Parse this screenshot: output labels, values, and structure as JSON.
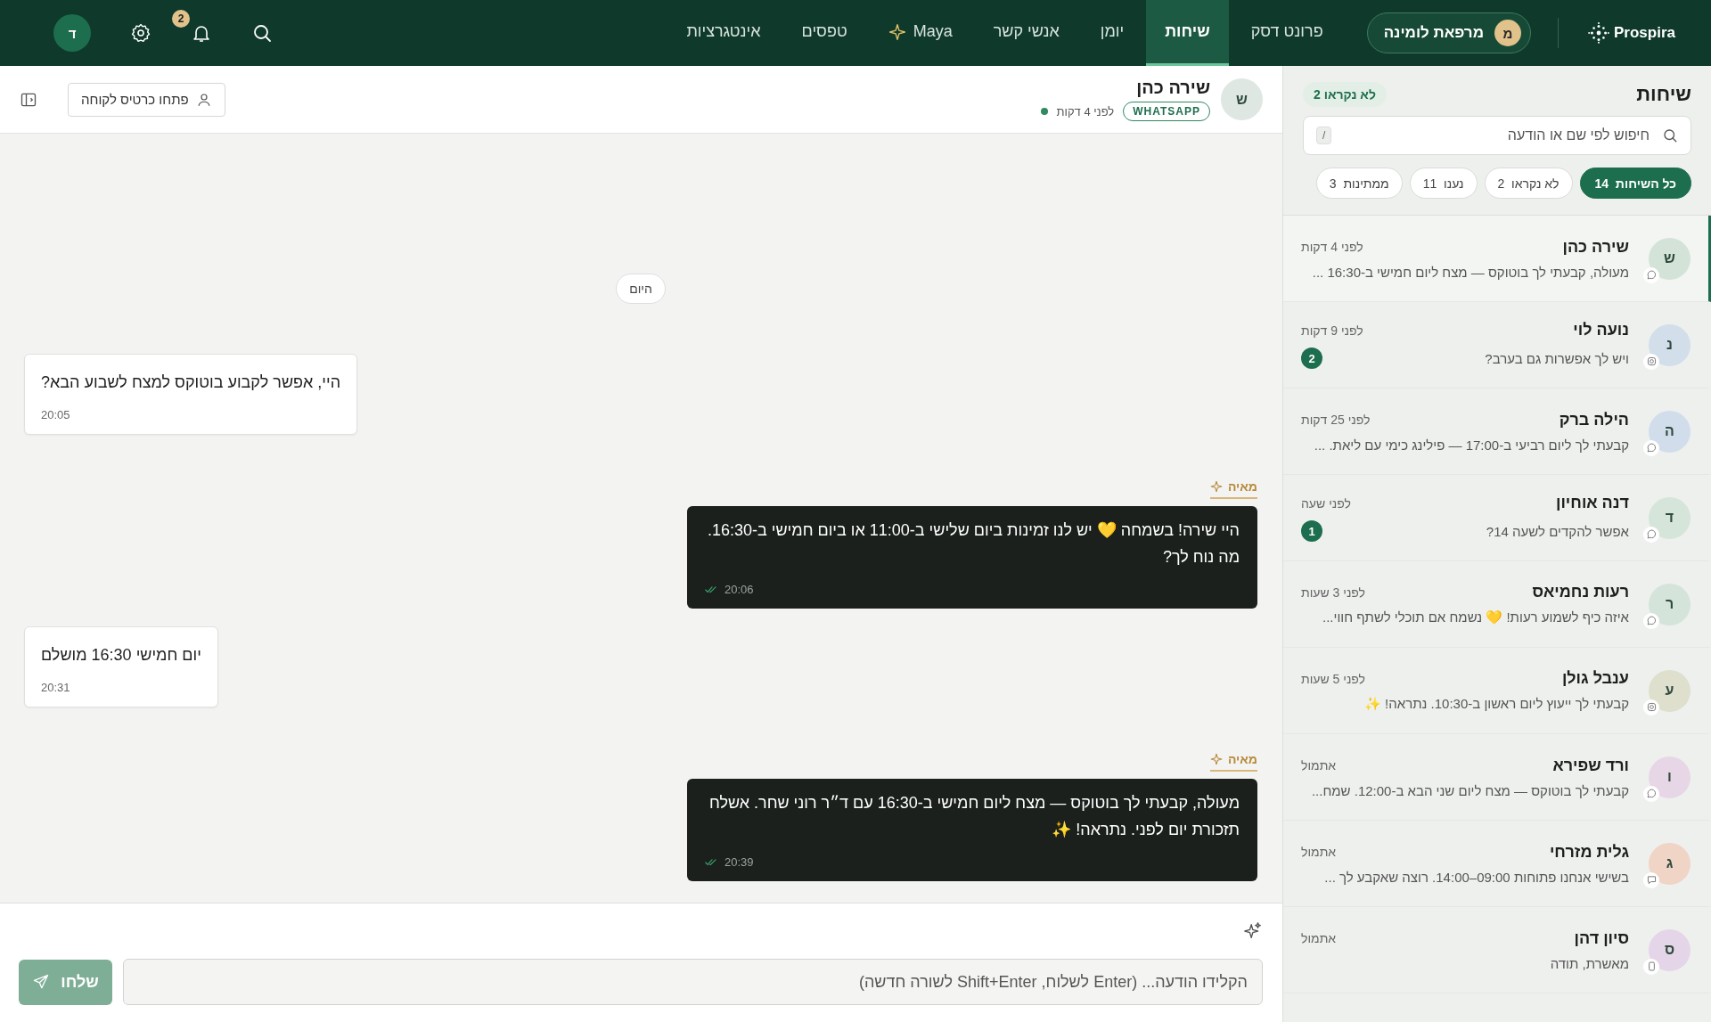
{
  "nav": {
    "brand": "Prospira",
    "clinic": {
      "initial": "מ",
      "name": "מרפאת לומינה"
    },
    "tabs": [
      {
        "label": "פרונט דסק",
        "kind": "plain",
        "selected": false
      },
      {
        "label": "שיחות",
        "kind": "plain",
        "selected": true
      },
      {
        "label": "יומן",
        "kind": "plain",
        "selected": false
      },
      {
        "label": "אנשי קשר",
        "kind": "plain",
        "selected": false
      },
      {
        "label": "Maya",
        "kind": "ai",
        "selected": false
      },
      {
        "label": "טפסים",
        "kind": "plain",
        "selected": false
      },
      {
        "label": "אינטגרציות",
        "kind": "plain",
        "selected": false
      }
    ],
    "notifications": "2",
    "user_initial": "ד"
  },
  "sidebar": {
    "title": "שיחות",
    "unread_badge": "לא נקראו 2",
    "search": {
      "placeholder": "חיפוש לפי שם או הודעה",
      "shortcut": "/"
    },
    "filters": [
      {
        "label": "כל השיחות",
        "count": "14",
        "selected": true
      },
      {
        "label": "לא נקראו",
        "count": "2",
        "selected": false
      },
      {
        "label": "נענו",
        "count": "11",
        "selected": false
      },
      {
        "label": "ממתינות",
        "count": "3",
        "selected": false
      }
    ],
    "conversations": [
      {
        "initial": "ש",
        "color": "#d3e3d7",
        "name": "שירה כהן",
        "time": "לפני 4 דקות",
        "preview": "מעולה, קבעתי לך בוטוקס — מצח ליום חמישי ב-16:30 ...",
        "kind": "whatsapp",
        "selected": true
      },
      {
        "initial": "נ",
        "color": "#d2deea",
        "name": "נועה לוי",
        "time": "לפני 9 דקות",
        "preview": "ויש לך אפשרות גם בערב?",
        "kind": "instagram",
        "unread": "2",
        "selected": false
      },
      {
        "initial": "ה",
        "color": "#d2ddec",
        "name": "הילה ברק",
        "time": "לפני 25 דקות",
        "preview": "קבעתי לך ליום רביעי ב-17:00 — פילינג כימי עם ליאת. ...",
        "kind": "whatsapp",
        "selected": false
      },
      {
        "initial": "ד",
        "color": "#d5e5d9",
        "name": "דנה אוחיון",
        "time": "לפני שעה",
        "preview": "אפשר להקדים לשעה 14?",
        "kind": "whatsapp",
        "unread": "1",
        "selected": false
      },
      {
        "initial": "ר",
        "color": "#d4e4da",
        "name": "רעות נחמיאס",
        "time": "לפני 3 שעות",
        "preview": "איזה כיף לשמוע רעות! 💛 נשמח אם תוכלי לשתף חווי...",
        "kind": "whatsapp",
        "selected": false
      },
      {
        "initial": "ע",
        "color": "#dfdfcd",
        "name": "ענבל גולן",
        "time": "לפני 5 שעות",
        "preview": "קבעתי לך ייעוץ ליום ראשון ב-10:30. נתראה! ✨",
        "kind": "instagram",
        "selected": false
      },
      {
        "initial": "ו",
        "color": "#e7d7e6",
        "name": "ורד שפירא",
        "time": "אתמול",
        "preview": "קבעתי לך בוטוקס — מצח ליום שני הבא ב-12:00. שמח...",
        "kind": "whatsapp",
        "selected": false
      },
      {
        "initial": "ג",
        "color": "#f0d4c6",
        "name": "גלית מזרחי",
        "time": "אתמול",
        "preview": "בשישי אנחנו פתוחות 09:00–14:00. רוצה שאקבע לך ...",
        "kind": "sms",
        "selected": false
      },
      {
        "initial": "ס",
        "color": "#e5d5e8",
        "name": "סיון דהן",
        "time": "אתמול",
        "preview": "מאשרת, תודה",
        "kind": "app",
        "selected": false
      }
    ]
  },
  "chat": {
    "contact": {
      "initial": "ש",
      "name": "שירה כהן",
      "channel": "WHATSAPP",
      "last_seen": "לפני 4 דקות",
      "online": true
    },
    "open_card_button": "פתחו כרטיס לקוחה",
    "messages": [
      {
        "kind": "date",
        "text": "היום"
      },
      {
        "kind": "incoming",
        "text": "היי, אפשר לקבוע בוטוקס למצח לשבוע הבא?",
        "time": "20:05"
      },
      {
        "kind": "outgoing",
        "author": "מאיה",
        "text": "היי שירה! בשמחה 💛 יש לנו זמינות ביום שלישי ב-11:00 או ביום חמישי ב-16:30. מה נוח לך?",
        "time": "20:06",
        "read": true
      },
      {
        "kind": "incoming",
        "text": "יום חמישי 16:30 מושלם",
        "time": "20:31"
      },
      {
        "kind": "outgoing",
        "author": "מאיה",
        "text": "מעולה, קבעתי לך בוטוקס — מצח ליום חמישי ב-16:30 עם ד״ר רוני שחר. אשלח תזכורת יום לפני. נתראה! ✨",
        "time": "20:39",
        "read": true
      }
    ],
    "composer": {
      "placeholder": "הקלידו הודעה... (Enter לשלוח, Shift+Enter לשורה חדשה)",
      "send": "שלחו"
    }
  }
}
